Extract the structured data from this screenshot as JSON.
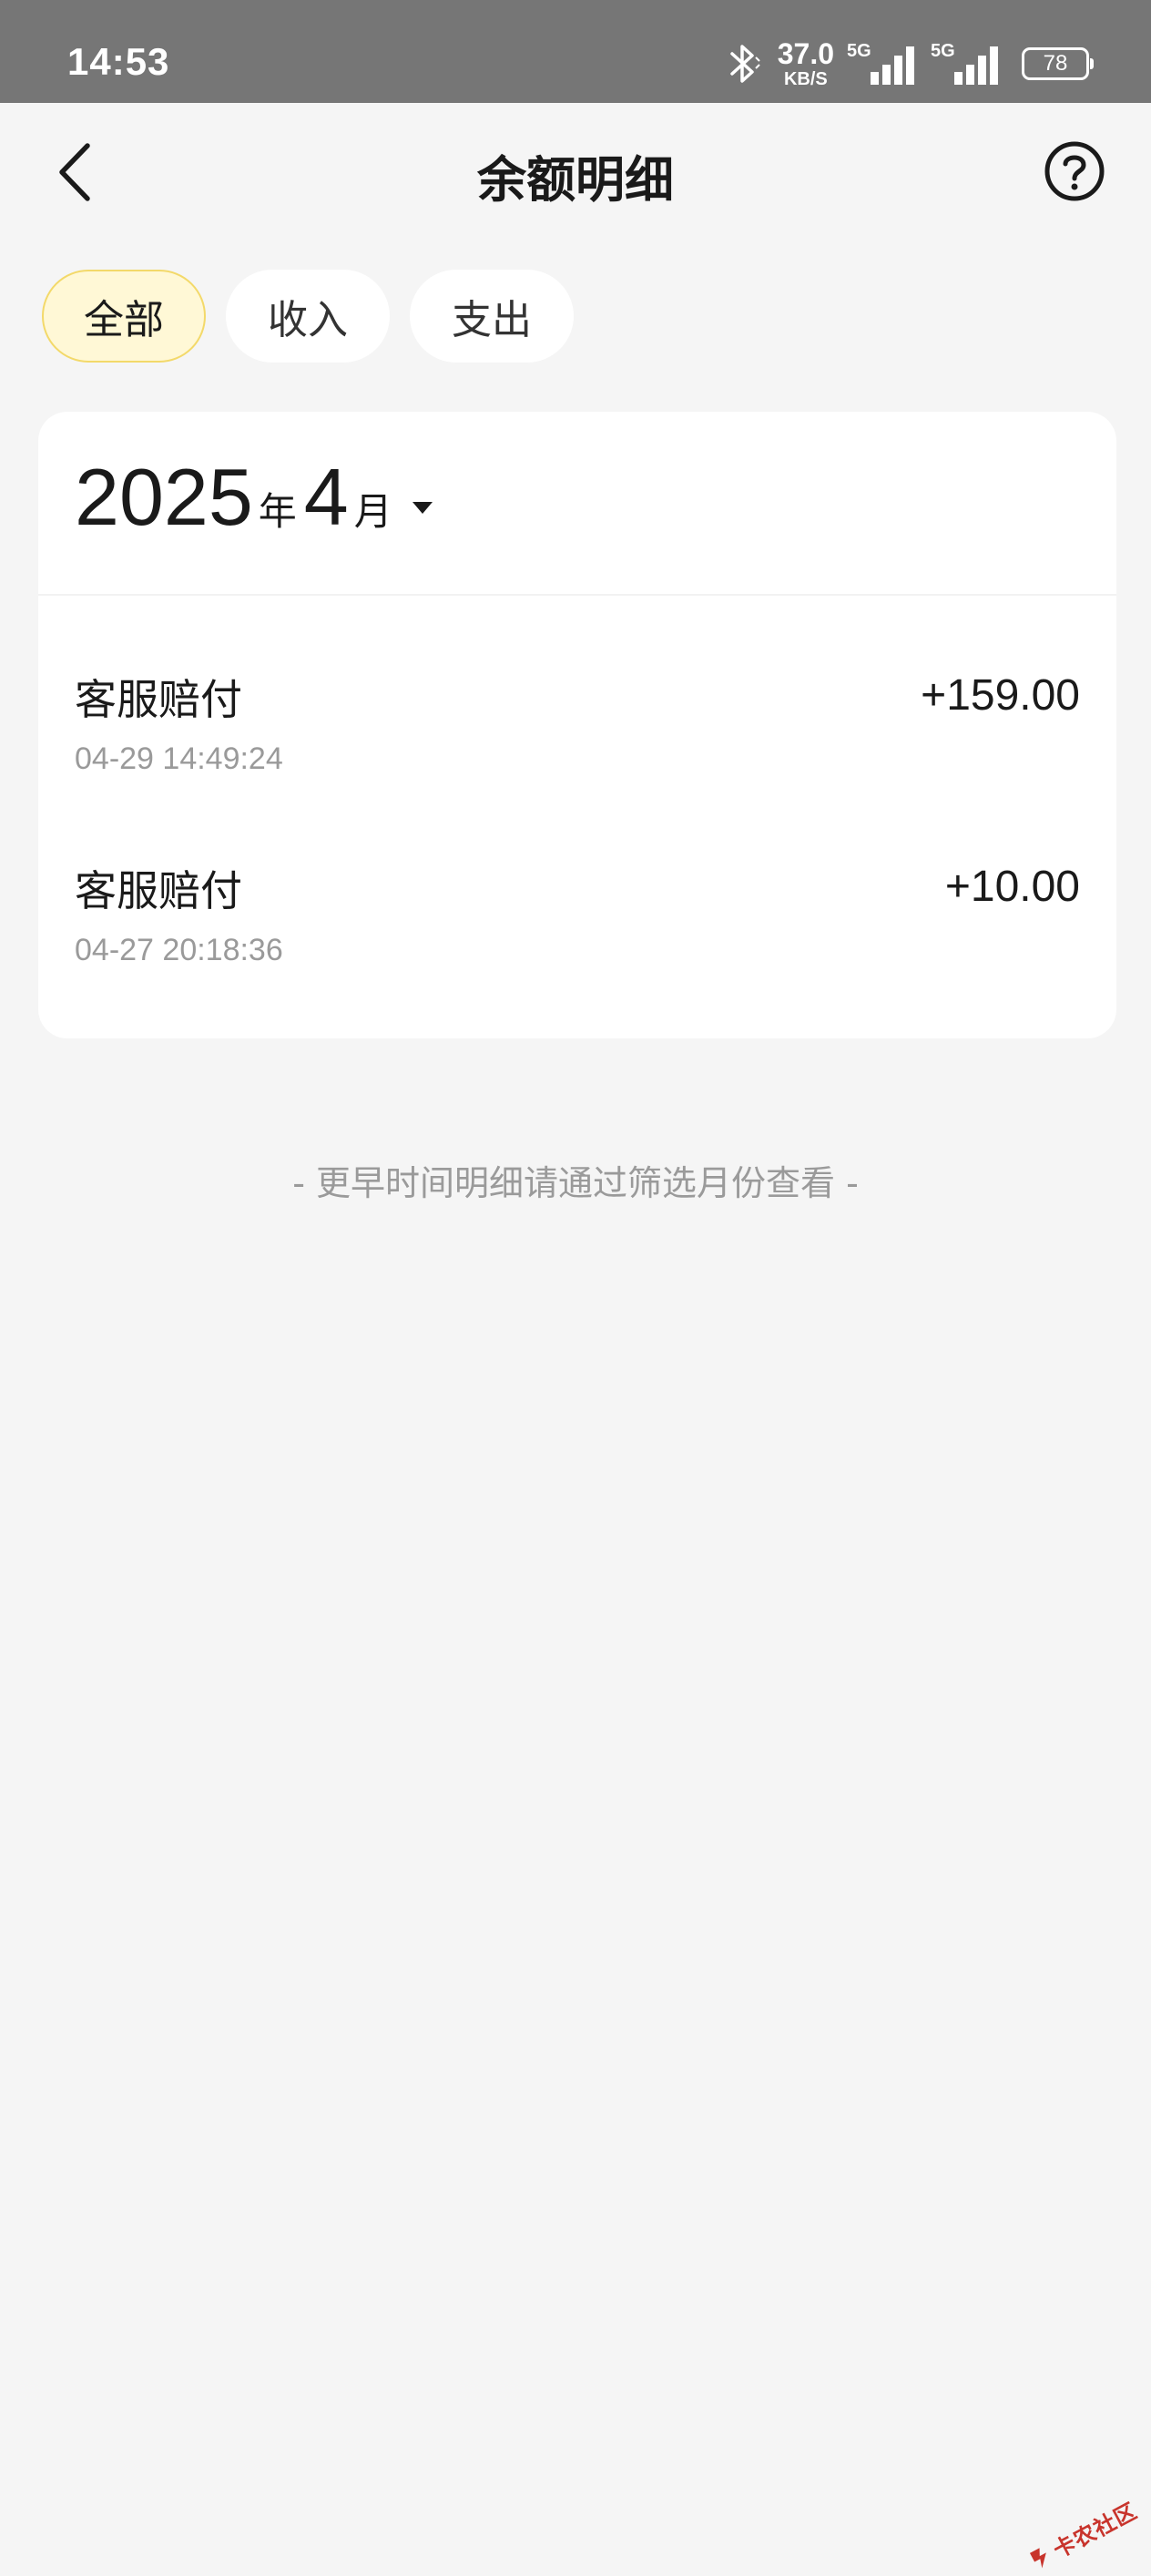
{
  "status_bar": {
    "time": "14:53",
    "net_speed_value": "37.0",
    "net_speed_unit": "KB/S",
    "signal_1_label": "5G",
    "signal_2_label": "5G",
    "battery": "78",
    "icons": [
      "bluetooth-icon",
      "signal-icon",
      "battery-icon"
    ]
  },
  "header": {
    "title": "余额明细",
    "back_icon": "chevron-left-icon",
    "help_icon": "question-circle-icon"
  },
  "filters": {
    "tabs": [
      {
        "label": "全部",
        "active": true
      },
      {
        "label": "收入",
        "active": false
      },
      {
        "label": "支出",
        "active": false
      }
    ]
  },
  "month_selector": {
    "year": "2025",
    "year_unit": "年",
    "month": "4",
    "month_unit": "月",
    "dropdown_icon": "caret-down-icon"
  },
  "records": [
    {
      "title": "客服赔付",
      "time": "04-29 14:49:24",
      "amount": "+159.00"
    },
    {
      "title": "客服赔付",
      "time": "04-27 20:18:36",
      "amount": "+10.00"
    }
  ],
  "footer_note": "- 更早时间明细请通过筛选月份查看 -",
  "watermark": {
    "text": "卡农社区"
  },
  "colors": {
    "status_bar_bg": "#767676",
    "page_bg": "#f5f5f5",
    "active_tab_bg": "#fff8d6",
    "active_tab_border": "#f3d96a",
    "muted_text": "#9a9a9a",
    "watermark": "#c8342c"
  }
}
